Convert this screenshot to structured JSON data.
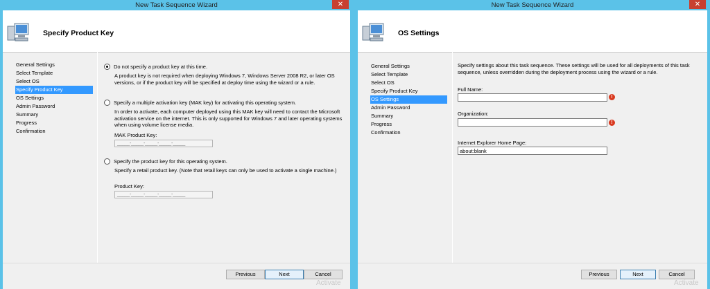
{
  "left_window": {
    "title": "New Task Sequence Wizard",
    "close_glyph": "✕",
    "page_title": "Specify Product Key",
    "nav": [
      "General Settings",
      "Select Template",
      "Select OS",
      "Specify Product Key",
      "OS Settings",
      "Admin Password",
      "Summary",
      "Progress",
      "Confirmation"
    ],
    "active_nav": "Specify Product Key",
    "options": {
      "no_key": {
        "label": "Do not specify a product key at this time.",
        "selected": true,
        "desc_line1": "A product key is not required when deploying Windows 7, Windows Server 2008 R2, or later OS",
        "desc_line2": "versions, or if the product key will be specified at deploy time using the wizard or a rule."
      },
      "mak": {
        "label": "Specify a multiple activation key (MAK key) for activating this operating system.",
        "selected": false,
        "desc_line1": "In order to activate, each computer deployed using this MAK key will need to contact the Microsoft",
        "desc_line2": "activation service on the internet.  This is only supported for Windows 7 and later operating systems",
        "desc_line3": "when using volume license media.",
        "field_label": "MAK Product Key:",
        "field_mask": "_____-_____-_____-_____-_____"
      },
      "retail": {
        "label": "Specify the product key for this operating system.",
        "selected": false,
        "desc_line1": "Specify a retail product key.  (Note that retail keys can only be used to activate a single machine.)",
        "field_label": "Product Key:",
        "field_mask": "_____-_____-_____-_____-_____"
      }
    },
    "buttons": {
      "previous": "Previous",
      "next": "Next",
      "cancel": "Cancel"
    },
    "watermark": "Activate"
  },
  "right_window": {
    "title": "New Task Sequence Wizard",
    "close_glyph": "✕",
    "page_title": "OS Settings",
    "nav": [
      "General Settings",
      "Select Template",
      "Select OS",
      "Specify Product Key",
      "OS Settings",
      "Admin Password",
      "Summary",
      "Progress",
      "Confirmation"
    ],
    "active_nav": "OS Settings",
    "intro_line1": "Specify settings about this task sequence.  These settings will be used for all deployments of this task",
    "intro_line2": "sequence, unless overridden during the deployment process using the wizard or a rule.",
    "fields": {
      "full_name": {
        "label": "Full Name:",
        "value": "",
        "error": true
      },
      "organization": {
        "label": "Organization:",
        "value": "",
        "error": true
      },
      "ie_home_page": {
        "label": "Internet Explorer Home Page:",
        "value": "about:blank"
      }
    },
    "buttons": {
      "previous": "Previous",
      "next": "Next",
      "cancel": "Cancel"
    },
    "watermark": "Activate"
  },
  "colors": {
    "desktop": "#5bc2e8",
    "selection": "#3399ff",
    "close": "#c84031",
    "error": "#d9391f"
  },
  "icons": {
    "header": "computer-monitor-icon",
    "error": "error-icon",
    "close": "close-icon"
  }
}
